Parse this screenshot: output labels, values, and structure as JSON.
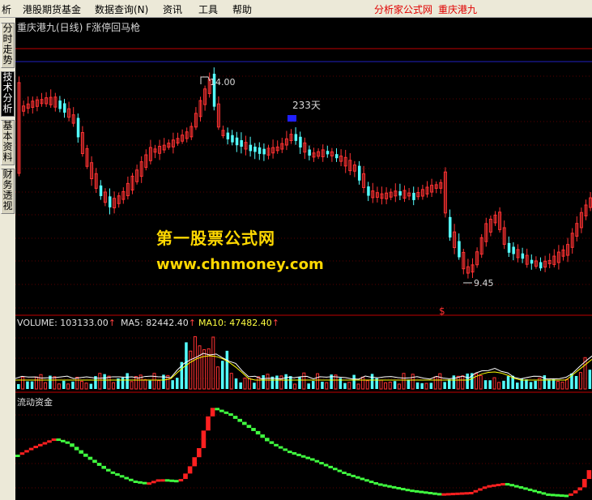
{
  "menu": {
    "items": [
      "析",
      "港股期货基金",
      "数据查询(N)",
      "资讯",
      "工具",
      "帮助"
    ],
    "brand": "分析家公式网",
    "stock_link": "重庆港九"
  },
  "sidebar": {
    "tabs": [
      "分时走势",
      "技术分析",
      "基本资料",
      "财务透视"
    ],
    "active": "技术分析"
  },
  "chart": {
    "title": "重庆港九(日线) F涨停回马枪",
    "high_label": "14.00",
    "low_label": "9.45",
    "days_label": "233天",
    "signal_glyph": "$",
    "watermark_cn": "第一股票公式网",
    "watermark_url": "www.chnmoney.com"
  },
  "volume_panel": {
    "volume_label": "VOLUME: 103133.00",
    "ma5_label": "MA5: 82442.40",
    "ma10_label": "MA10: 47482.40",
    "arrow": "↑"
  },
  "flow_panel": {
    "label": "流动资金"
  },
  "colors": {
    "up": "#ff3232",
    "down": "#54ffff",
    "ma5": "#ffffff",
    "ma10": "#ffff00",
    "flow_up": "#ff2020",
    "flow_down": "#40ff40",
    "signal_box": "#2020ff",
    "watermark": "#ffd800"
  }
}
